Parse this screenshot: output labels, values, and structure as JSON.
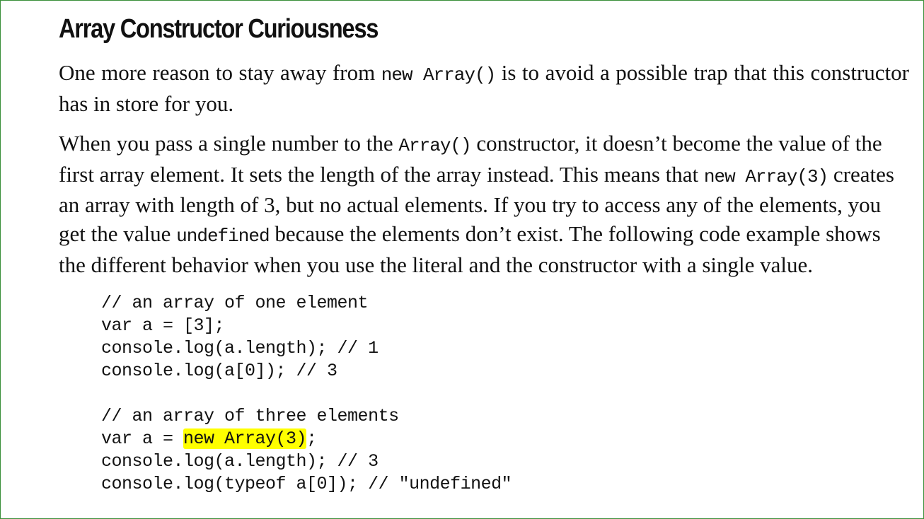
{
  "title": "Array Constructor Curiousness",
  "paragraph1": {
    "t1": "One more reason to stay away from ",
    "c1": "new Array()",
    "t2": " is to avoid a possible trap that this constructor has in store for you."
  },
  "paragraph2": {
    "t1": "When you pass a single number to the ",
    "c1": "Array()",
    "t2": " constructor, it doesn’t become the value of the first array element. It sets the length of the array instead. This means that ",
    "c2": "new Array(3)",
    "t3": " creates an array with length of 3, but no actual elements. If you try to access any of the elements, you get the value ",
    "c3": "undefined",
    "t4": " because the elements don’t exist. The following code example shows the different behavior when you use the literal and the constructor with a single value."
  },
  "code": {
    "line1": "// an array of one element",
    "line2": "var a = [3];",
    "line3": "console.log(a.length); // 1",
    "line4": "console.log(a[0]); // 3",
    "line5": "",
    "line6": "// an array of three elements",
    "line7_pre": "var a = ",
    "line7_highlight": "new Array(3)",
    "line7_post": ";",
    "line8": "console.log(a.length); // 3",
    "line9": "console.log(typeof a[0]); // \"undefined\""
  },
  "colors": {
    "border": "#3a8f3a",
    "highlight": "#ffff00"
  }
}
